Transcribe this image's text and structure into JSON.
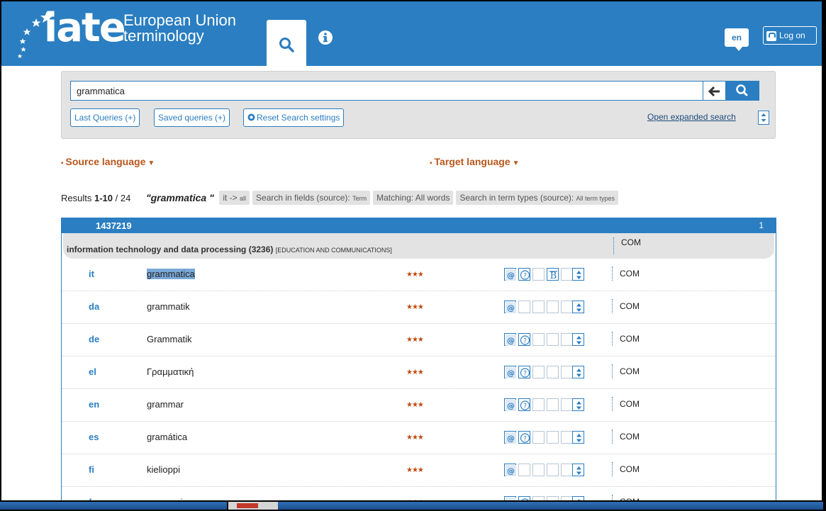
{
  "header": {
    "logo_text": "iate",
    "subtitle_line1": "European Union",
    "subtitle_line2": "terminology",
    "language": "en",
    "login_label": "Log on"
  },
  "search": {
    "query": "grammatica",
    "buttons": {
      "last_queries": "Last Queries (+)",
      "saved_queries": "Saved queries (+)",
      "reset": "Reset Search settings",
      "expanded": "Open expanded search"
    }
  },
  "languages": {
    "source": "Source language",
    "target": "Target language"
  },
  "results": {
    "prefix": "Results",
    "range": "1-10",
    "total": "/ 24",
    "query": "\"grammatica \"",
    "tags": [
      {
        "main": "it -> ",
        "small": "all"
      },
      {
        "main": "Search in fields (source): ",
        "small": "Term"
      },
      {
        "main": "Matching: All words",
        "small": ""
      },
      {
        "main": "Search in term types (source): ",
        "small": "All term types"
      }
    ]
  },
  "entry": {
    "id": "1437219",
    "count": "1",
    "domain": "information technology and data processing (3236)",
    "domain_parent": "[EDUCATION AND COMMUNICATIONS]",
    "domain_ref": "COM",
    "rows": [
      {
        "lang": "it",
        "term": "grammatica",
        "stars": "★★★",
        "ref": "COM"
      },
      {
        "lang": "da",
        "term": "grammatik",
        "stars": "★★★",
        "ref": "COM"
      },
      {
        "lang": "de",
        "term": "Grammatik",
        "stars": "★★★",
        "ref": "COM"
      },
      {
        "lang": "el",
        "term": "Γραμματική",
        "stars": "★★★",
        "ref": "COM"
      },
      {
        "lang": "en",
        "term": "grammar",
        "stars": "★★★",
        "ref": "COM"
      },
      {
        "lang": "es",
        "term": "gramática",
        "stars": "★★★",
        "ref": "COM"
      },
      {
        "lang": "fi",
        "term": "kielioppi",
        "stars": "★★★",
        "ref": "COM"
      },
      {
        "lang": "fr",
        "term": "grammaire",
        "stars": "★★★",
        "ref": "COM"
      }
    ]
  },
  "colors": {
    "brand": "#2a7ec1",
    "accent": "#b8561b",
    "stars": "#c24a12"
  }
}
